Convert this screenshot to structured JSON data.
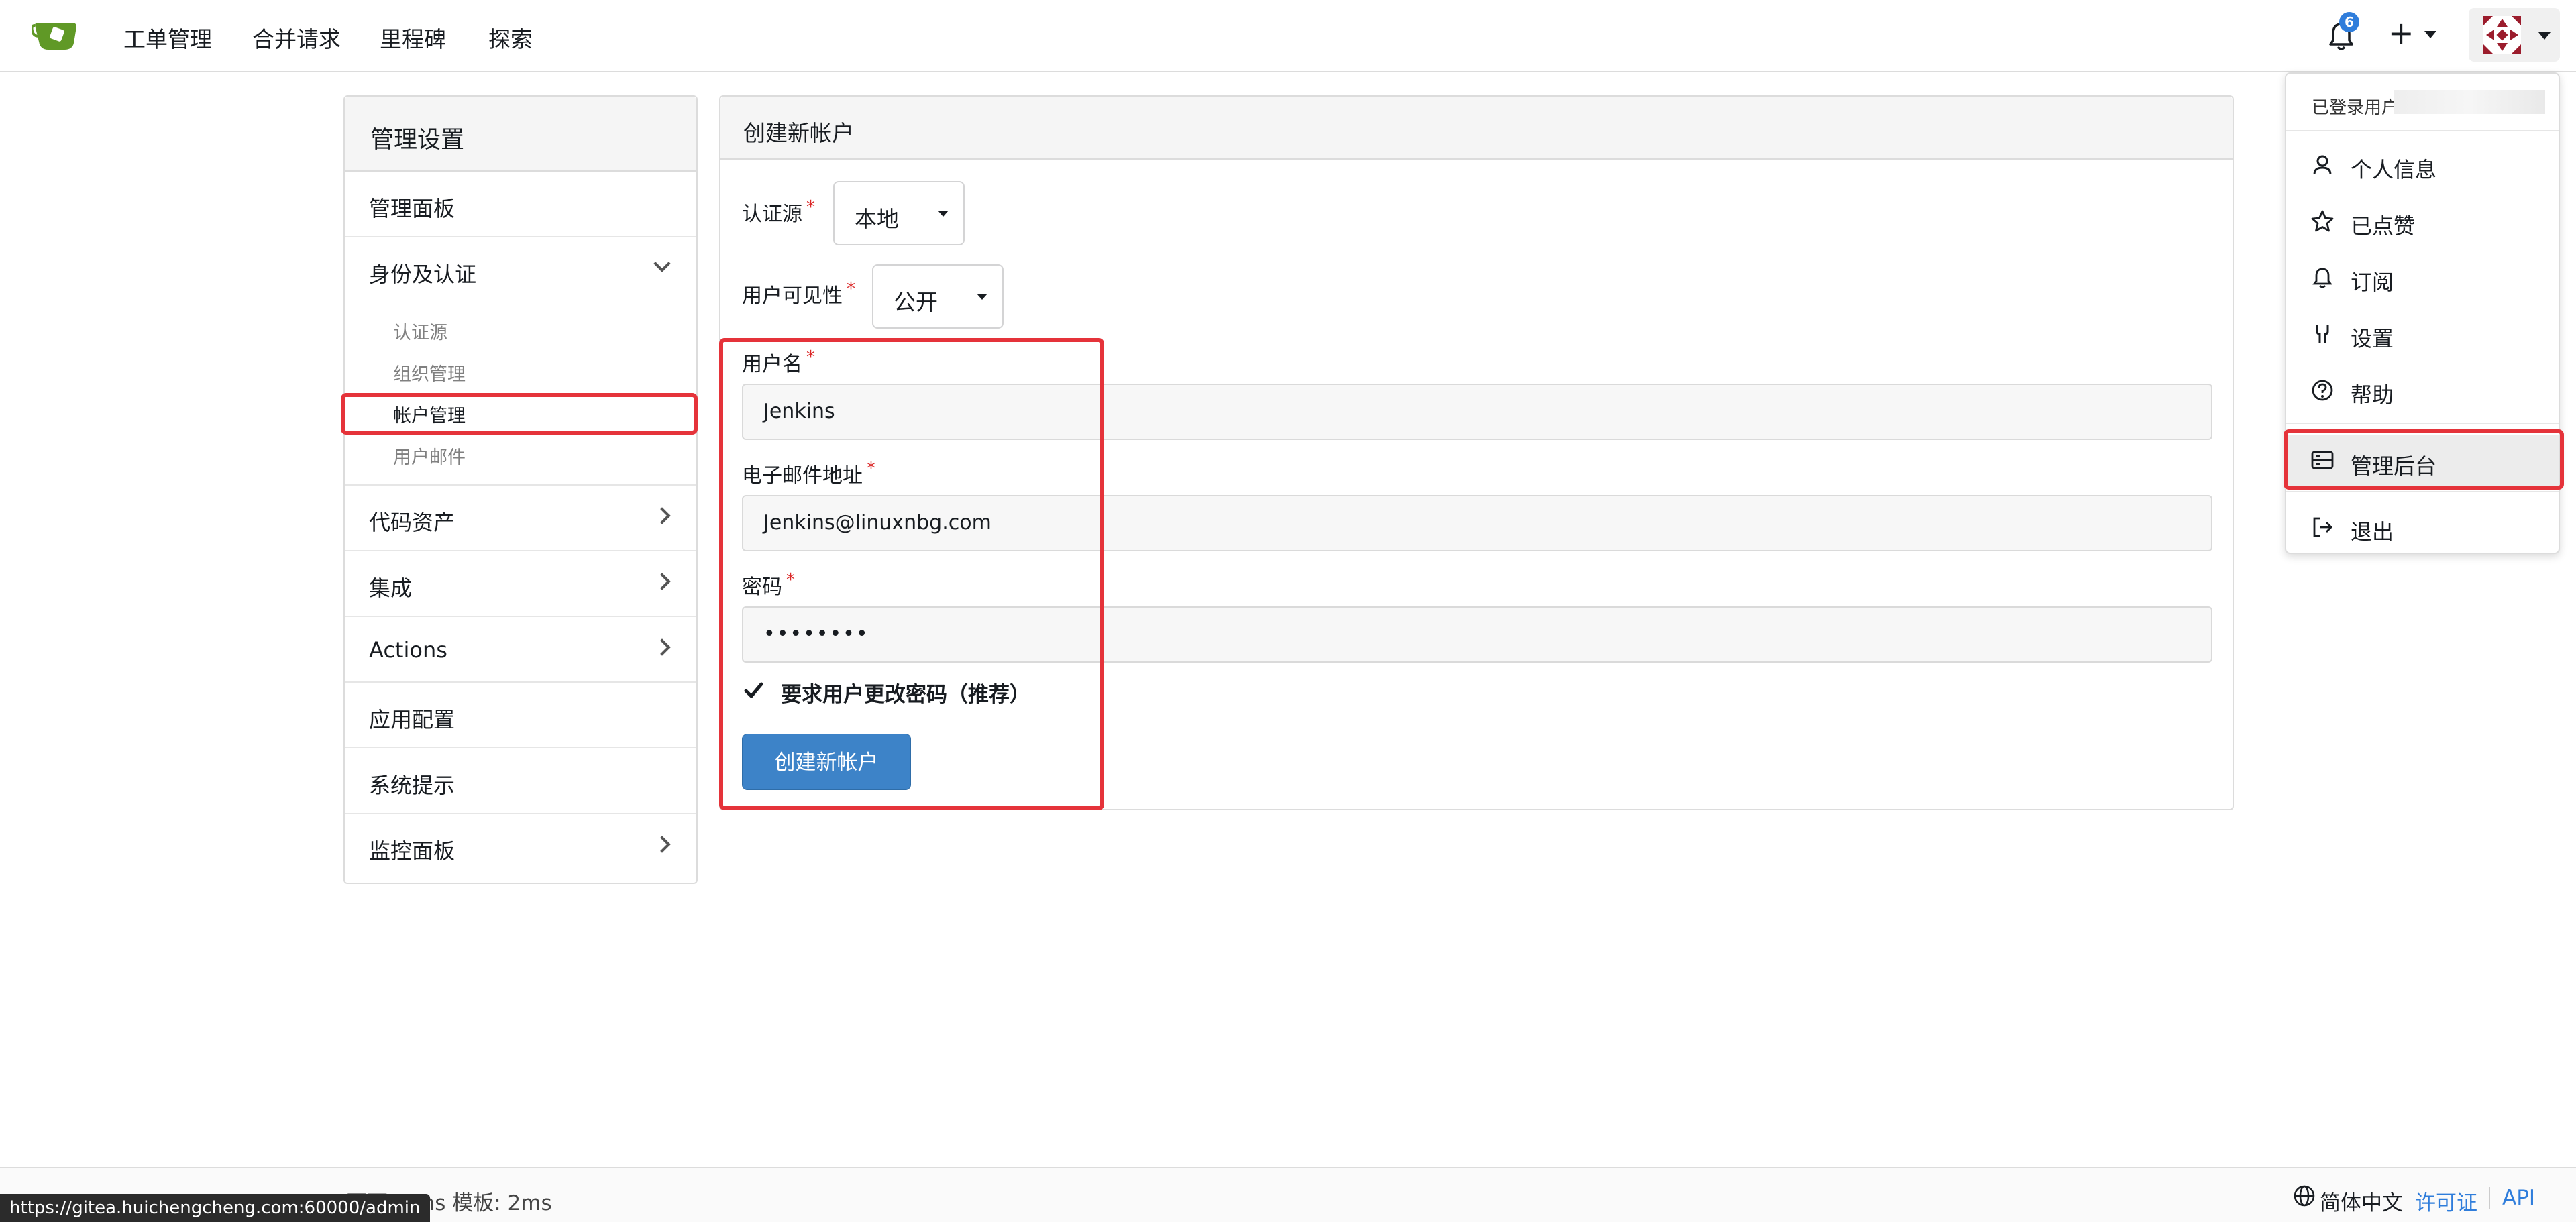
{
  "navbar": {
    "items": [
      "工单管理",
      "合并请求",
      "里程碑",
      "探索"
    ],
    "notification_count": "6"
  },
  "sidebar": {
    "title": "管理设置",
    "items": [
      {
        "label": "管理面板"
      },
      {
        "label": "身份及认证"
      },
      {
        "label": "代码资产"
      },
      {
        "label": "集成"
      },
      {
        "label": "Actions"
      },
      {
        "label": "应用配置"
      },
      {
        "label": "系统提示"
      },
      {
        "label": "监控面板"
      }
    ],
    "subitems": [
      "认证源",
      "组织管理",
      "帐户管理",
      "用户邮件"
    ]
  },
  "form": {
    "title": "创建新帐户",
    "auth_source_label": "认证源",
    "auth_source_value": "本地",
    "visibility_label": "用户可见性",
    "visibility_value": "公开",
    "username_label": "用户名",
    "username_value": "Jenkins",
    "email_label": "电子邮件地址",
    "email_value": "Jenkins@linuxnbg.com",
    "password_label": "密码",
    "password_value": "••••••••",
    "must_change_label": "要求用户更改密码（推荐）",
    "submit_label": "创建新帐户"
  },
  "menu": {
    "header": "已登录用户",
    "items": [
      "个人信息",
      "已点赞",
      "订阅",
      "设置",
      "帮助",
      "管理后台",
      "退出"
    ]
  },
  "footer": {
    "left_text": "页面: 4ms 模板: 2ms",
    "language": "简体中文",
    "license": "许可证",
    "api": "API"
  },
  "status_url": "https://gitea.huichengcheng.com:60000/admin",
  "colors": {
    "primary": "#3d83c8",
    "highlight": "#e5333a",
    "badge": "#2f7ddb",
    "logo": "#609926"
  }
}
